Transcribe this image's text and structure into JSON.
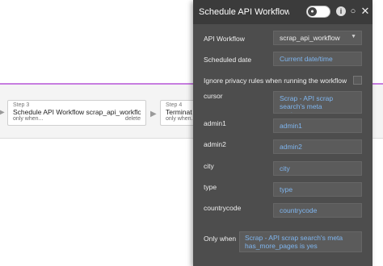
{
  "workflow": {
    "step3": {
      "step_label": "Step 3",
      "title": "Schedule API Workflow scrap_api_workflow",
      "condition": "only when...",
      "delete_label": "delete"
    },
    "step4": {
      "step_label": "Step 4",
      "title": "Terminat",
      "condition": "only when..."
    }
  },
  "panel": {
    "title": "Schedule API Workflow s",
    "api_workflow": {
      "label": "API Workflow",
      "value": "scrap_api_workflow"
    },
    "scheduled_date": {
      "label": "Scheduled date",
      "value": "Current date/time"
    },
    "ignore_privacy": {
      "label": "Ignore privacy rules when running the workflow"
    },
    "cursor": {
      "label": "cursor",
      "value": "Scrap - API scrap search's meta next_cursor"
    },
    "admin1": {
      "label": "admin1",
      "value": "admin1"
    },
    "admin2": {
      "label": "admin2",
      "value": "admin2"
    },
    "city": {
      "label": "city",
      "value": "city"
    },
    "type": {
      "label": "type",
      "value": "type"
    },
    "countrycode": {
      "label": "countrycode",
      "value": "countrycode"
    },
    "only_when": {
      "label": "Only when",
      "value": "Scrap - API scrap search's meta has_more_pages is yes"
    }
  },
  "colors": {
    "panel_bg": "#4d4d4d",
    "header_bg": "#3b3b3b",
    "dynamic_text": "#7fb6f0",
    "workflow_line": "#c77de0"
  }
}
